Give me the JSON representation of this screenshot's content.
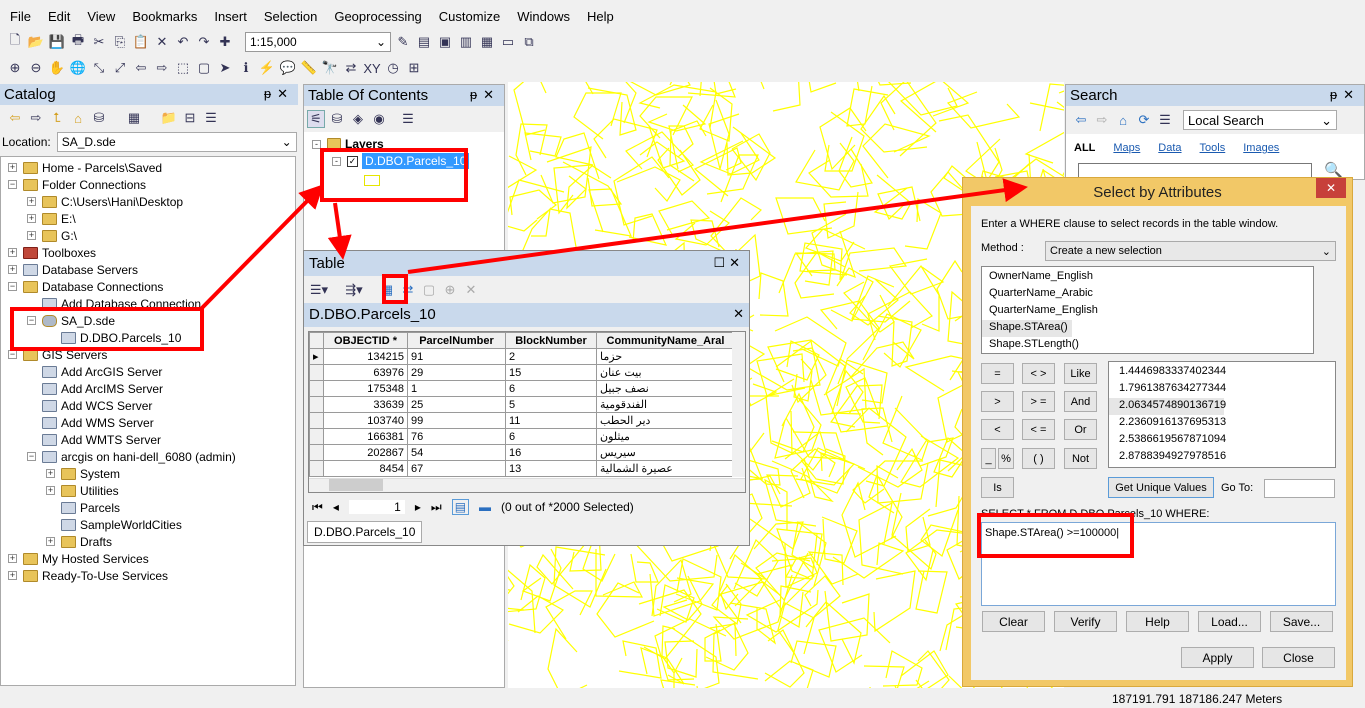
{
  "menu": [
    "File",
    "Edit",
    "View",
    "Bookmarks",
    "Insert",
    "Selection",
    "Geoprocessing",
    "Customize",
    "Windows",
    "Help"
  ],
  "toolbar": {
    "scale": "1:15,000"
  },
  "catalog": {
    "title": "Catalog",
    "location_label": "Location:",
    "location_value": "SA_D.sde",
    "tree": [
      {
        "label": "Home - Parcels\\Saved",
        "level": 0,
        "exp": "+",
        "icon": "home-folder"
      },
      {
        "label": "Folder Connections",
        "level": 0,
        "exp": "-",
        "icon": "folder"
      },
      {
        "label": "C:\\Users\\Hani\\Desktop",
        "level": 1,
        "exp": "+",
        "icon": "folder"
      },
      {
        "label": "E:\\",
        "level": 1,
        "exp": "+",
        "icon": "folder"
      },
      {
        "label": "G:\\",
        "level": 1,
        "exp": "+",
        "icon": "folder"
      },
      {
        "label": "Toolboxes",
        "level": 0,
        "exp": "+",
        "icon": "toolbox"
      },
      {
        "label": "Database Servers",
        "level": 0,
        "exp": "+",
        "icon": "server"
      },
      {
        "label": "Database Connections",
        "level": 0,
        "exp": "-",
        "icon": "folder"
      },
      {
        "label": "Add Database Connection",
        "level": 1,
        "exp": "",
        "icon": "server"
      },
      {
        "label": "SA_D.sde",
        "level": 1,
        "exp": "-",
        "icon": "database"
      },
      {
        "label": "D.DBO.Parcels_10",
        "level": 2,
        "exp": "",
        "icon": "feature-class"
      },
      {
        "label": "GIS Servers",
        "level": 0,
        "exp": "-",
        "icon": "folder"
      },
      {
        "label": "Add ArcGIS Server",
        "level": 1,
        "exp": "",
        "icon": "server"
      },
      {
        "label": "Add ArcIMS Server",
        "level": 1,
        "exp": "",
        "icon": "server"
      },
      {
        "label": "Add WCS Server",
        "level": 1,
        "exp": "",
        "icon": "server"
      },
      {
        "label": "Add WMS Server",
        "level": 1,
        "exp": "",
        "icon": "server"
      },
      {
        "label": "Add WMTS Server",
        "level": 1,
        "exp": "",
        "icon": "server"
      },
      {
        "label": "arcgis on hani-dell_6080 (admin)",
        "level": 1,
        "exp": "-",
        "icon": "server"
      },
      {
        "label": "System",
        "level": 2,
        "exp": "+",
        "icon": "folder"
      },
      {
        "label": "Utilities",
        "level": 2,
        "exp": "+",
        "icon": "folder"
      },
      {
        "label": "Parcels",
        "level": 2,
        "exp": "",
        "icon": "service"
      },
      {
        "label": "SampleWorldCities",
        "level": 2,
        "exp": "",
        "icon": "service"
      },
      {
        "label": "Drafts",
        "level": 2,
        "exp": "+",
        "icon": "folder"
      },
      {
        "label": "My Hosted Services",
        "level": 0,
        "exp": "+",
        "icon": "folder"
      },
      {
        "label": "Ready-To-Use Services",
        "level": 0,
        "exp": "+",
        "icon": "folder"
      }
    ]
  },
  "toc": {
    "title": "Table Of Contents",
    "layers_label": "Layers",
    "layer": "D.DBO.Parcels_10"
  },
  "table": {
    "title": "Table",
    "table_name": "D.DBO.Parcels_10",
    "columns": [
      "OBJECTID *",
      "ParcelNumber",
      "BlockNumber",
      "CommunityName_Aral"
    ],
    "rows": [
      [
        "134215",
        "91",
        "2",
        "حزما"
      ],
      [
        "63976",
        "29",
        "15",
        "بيت عنان"
      ],
      [
        "175348",
        "1",
        "6",
        "نصف جبيل"
      ],
      [
        "33639",
        "25",
        "5",
        "الفندقومية"
      ],
      [
        "103740",
        "99",
        "11",
        "دير الحطب"
      ],
      [
        "166381",
        "76",
        "6",
        "ميثلون"
      ],
      [
        "202867",
        "54",
        "16",
        "سيريس"
      ],
      [
        "8454",
        "67",
        "13",
        "عصيرة الشمالية"
      ]
    ],
    "page": "1",
    "selection_status": "(0 out of *2000 Selected)",
    "tab": "D.DBO.Parcels_10"
  },
  "search": {
    "title": "Search",
    "scope": "Local Search",
    "tabs": [
      "ALL",
      "Maps",
      "Data",
      "Tools",
      "Images"
    ]
  },
  "dialog": {
    "title": "Select by Attributes",
    "instructions": "Enter a WHERE clause to select records in the table window.",
    "method_label": "Method :",
    "method_value": "Create a new selection",
    "fields": [
      "OwnerName_English",
      "QuarterName_Arabic",
      "QuarterName_English",
      "Shape.STArea()",
      "Shape.STLength()"
    ],
    "operators": [
      "=",
      "< >",
      "Like",
      "&gt;",
      "> =",
      "And",
      "<",
      "< =",
      "Or",
      "_",
      "%",
      "( )",
      "Not",
      "Is"
    ],
    "values": [
      "1.4446983337402344",
      "1.7961387634277344",
      "2.0634574890136719",
      "2.2360916137695313",
      "2.5386619567871094",
      "2.8788394927978516"
    ],
    "get_unique": "Get Unique Values",
    "goto_label": "Go To:",
    "sql_prefix": "SELECT * FROM D.DBO.Parcels_10 WHERE:",
    "expression": "Shape.STArea() >=100000",
    "buttons": [
      "Clear",
      "Verify",
      "Help",
      "Load...",
      "Save..."
    ],
    "apply": "Apply",
    "close": "Close"
  },
  "status": {
    "coords": "187191.791  187186.247 Meters"
  },
  "colors": {
    "annotation": "#ff0000",
    "parcel_lines": "#ffff00",
    "dialog_frame": "#f2c867"
  }
}
